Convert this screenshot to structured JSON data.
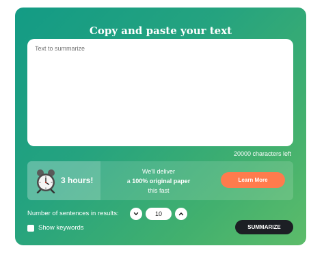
{
  "header": {
    "title": "Copy and paste your text"
  },
  "input": {
    "placeholder": "Text to summarize",
    "value": ""
  },
  "char_counter": "20000 characters left",
  "promo": {
    "clock_icon": "alarm-clock-icon",
    "hours": "3 hours!",
    "line1": "We'll deliver",
    "line2_prefix": "a ",
    "line2_bold": "100% original paper",
    "line3": "this fast",
    "button": "Learn More",
    "button_color": "#ff7b4d"
  },
  "controls": {
    "sentences_label": "Number of sentences in results:",
    "sentences_value": "10",
    "decrement_icon": "chevron-down-icon",
    "increment_icon": "chevron-up-icon",
    "keywords_label": "Show keywords",
    "keywords_checked": false,
    "summarize": "SUMMARIZE"
  },
  "colors": {
    "gradient_start": "#139b85",
    "gradient_end": "#5dbc6a",
    "dark_button": "#1c1f24"
  }
}
